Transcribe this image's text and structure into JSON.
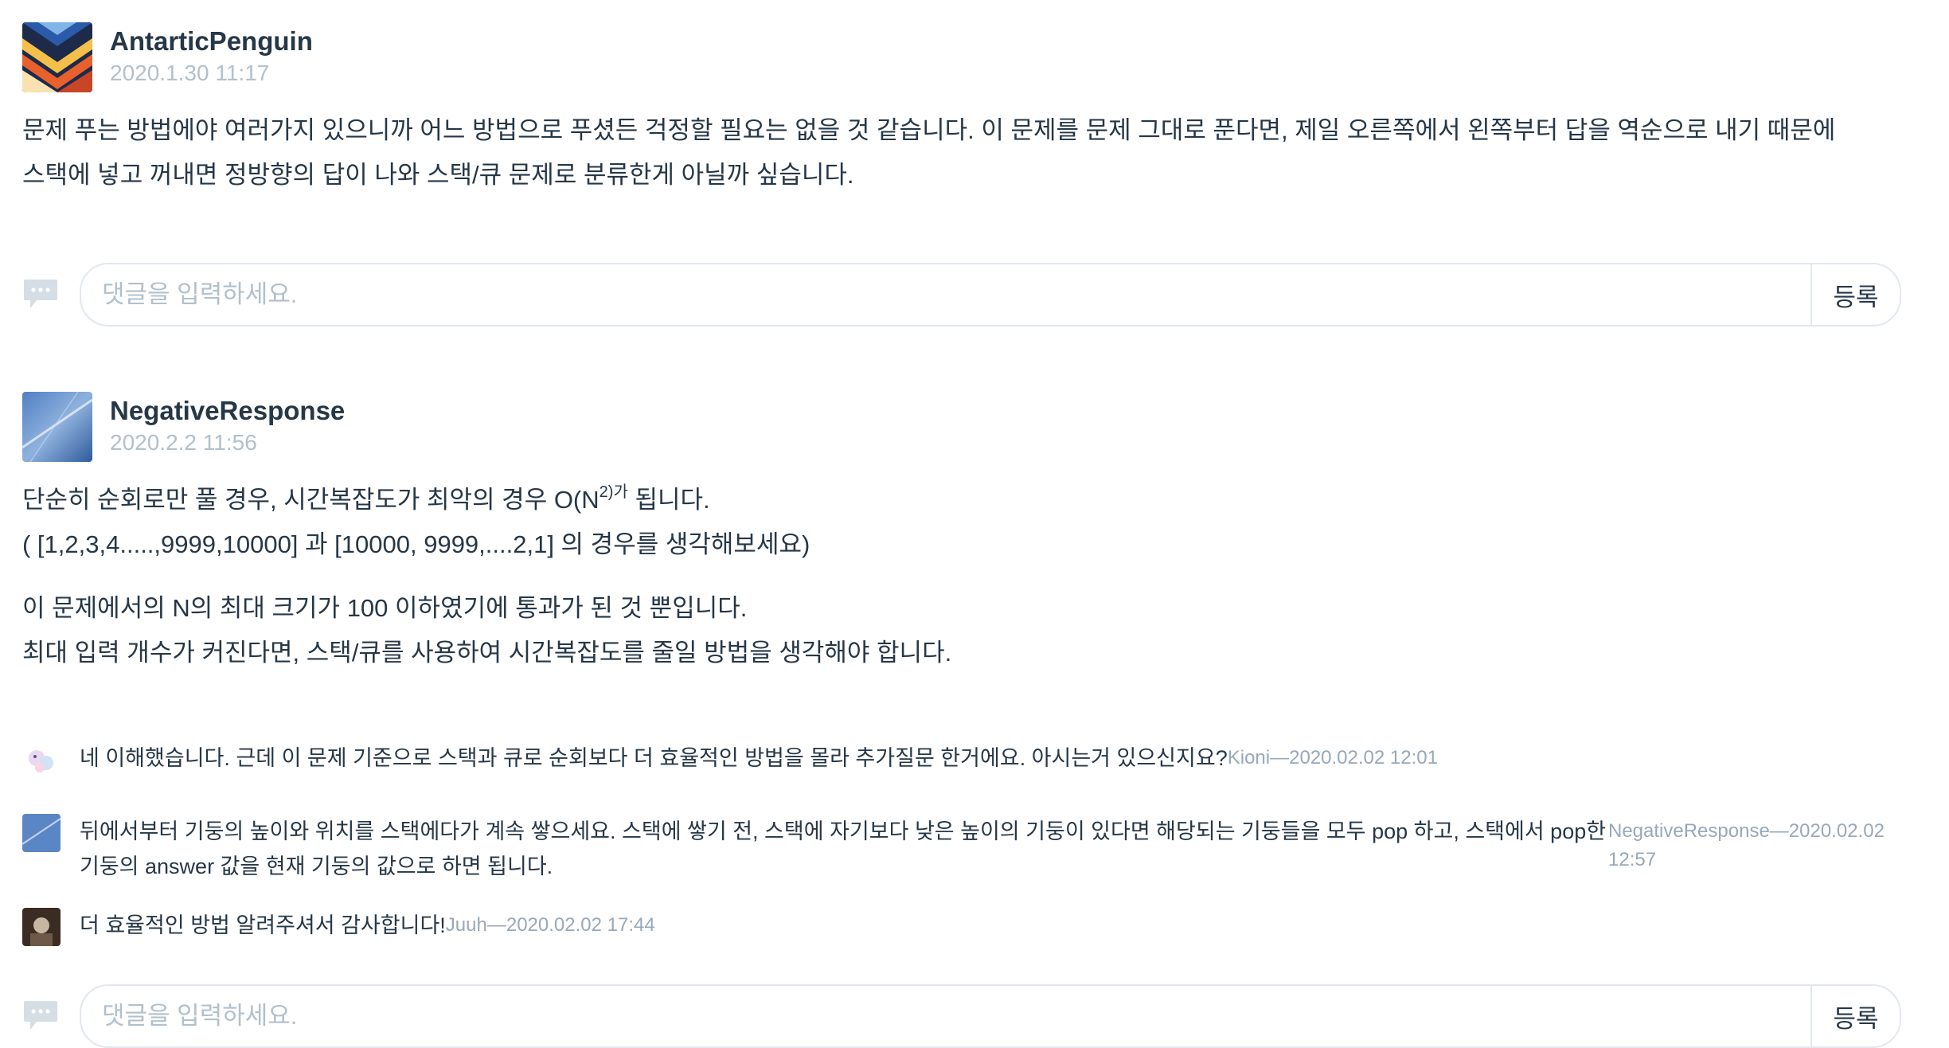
{
  "posts": [
    {
      "author": "AntarticPenguin",
      "date": "2020.1.30 11:17",
      "paragraphs": [
        "문제 푸는 방법에야 여러가지 있으니까 어느 방법으로 푸셨든 걱정할 필요는 없을 것 같습니다. 이 문제를 문제 그대로 푼다면, 제일 오른쪽에서 왼쪽부터 답을 역순으로 내기 때문에",
        "스택에 넣고 꺼내면 정방향의 답이 나와 스택/큐 문제로 분류한게 아닐까 싶습니다."
      ]
    },
    {
      "author": "NegativeResponse",
      "date": "2020.2.2 11:56",
      "line1_prefix": "단순히 순회로만 풀 경우, 시간복잡도가 최악의 경우 O(N",
      "line1_sup": "2)가",
      "line1_suffix": " 됩니다.",
      "line2": "( [1,2,3,4.....,9999,10000] 과 [10000, 9999,....2,1] 의 경우를 생각해보세요)",
      "line3": "이 문제에서의 N의 최대 크기가 100 이하였기에 통과가 된 것 뿐입니다.",
      "line4": "최대 입력 개수가 커진다면, 스택/큐를 사용하여 시간복잡도를 줄일 방법을 생각해야 합니다."
    }
  ],
  "replies": [
    {
      "text": "네 이해했습니다. 근데 이 문제 기준으로 스택과 큐로 순회보다 더 효율적인 방법을 몰라 추가질문 한거에요. 아시는거 있으신지요?",
      "meta": "Kioni—2020.02.02 12:01"
    },
    {
      "text": "뒤에서부터 기둥의 높이와 위치를 스택에다가 계속 쌓으세요. 스택에 쌓기 전, 스택에 자기보다 낮은 높이의 기둥이 있다면 해당되는 기둥들을 모두 pop 하고, 스택에서 pop한 기둥의 answer 값을 현재 기둥의 값으로 하면 됩니다.",
      "meta": "NegativeResponse—2020.02.02 12:57"
    },
    {
      "text": "더 효율적인 방법 알려주셔서 감사합니다!",
      "meta": "Juuh—2020.02.02 17:44"
    }
  ],
  "comment_form": {
    "placeholder": "댓글을 입력하세요.",
    "submit_label": "등록"
  },
  "icons": {
    "comment": "speech-bubble-icon"
  },
  "colors": {
    "text": "#263747",
    "muted": "#b2c0cc",
    "border": "#e2e8ee"
  }
}
